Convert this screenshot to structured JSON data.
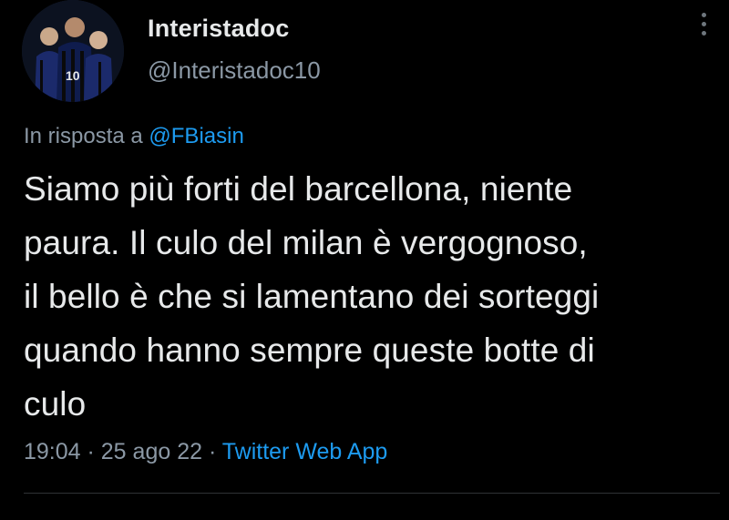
{
  "tweet": {
    "author": {
      "name": "Interistadoc",
      "handle": "@Interistadoc10"
    },
    "reply": {
      "prefix": "In risposta a ",
      "mention": "@FBiasin"
    },
    "text_lines": [
      "Siamo più forti del barcellona, niente",
      "paura. Il culo del milan è vergognoso,",
      "il bello è che si lamentano dei sorteggi",
      "quando hanno sempre queste botte di",
      "culo"
    ],
    "time": "19:04",
    "separator": " · ",
    "date": "25 ago 22",
    "source": "Twitter Web App"
  },
  "colors": {
    "background": "#000000",
    "text": "#e7e9ea",
    "secondary": "#8b98a5",
    "accent": "#1d9bf0"
  },
  "icons": {
    "more": "more-vertical-icon"
  }
}
